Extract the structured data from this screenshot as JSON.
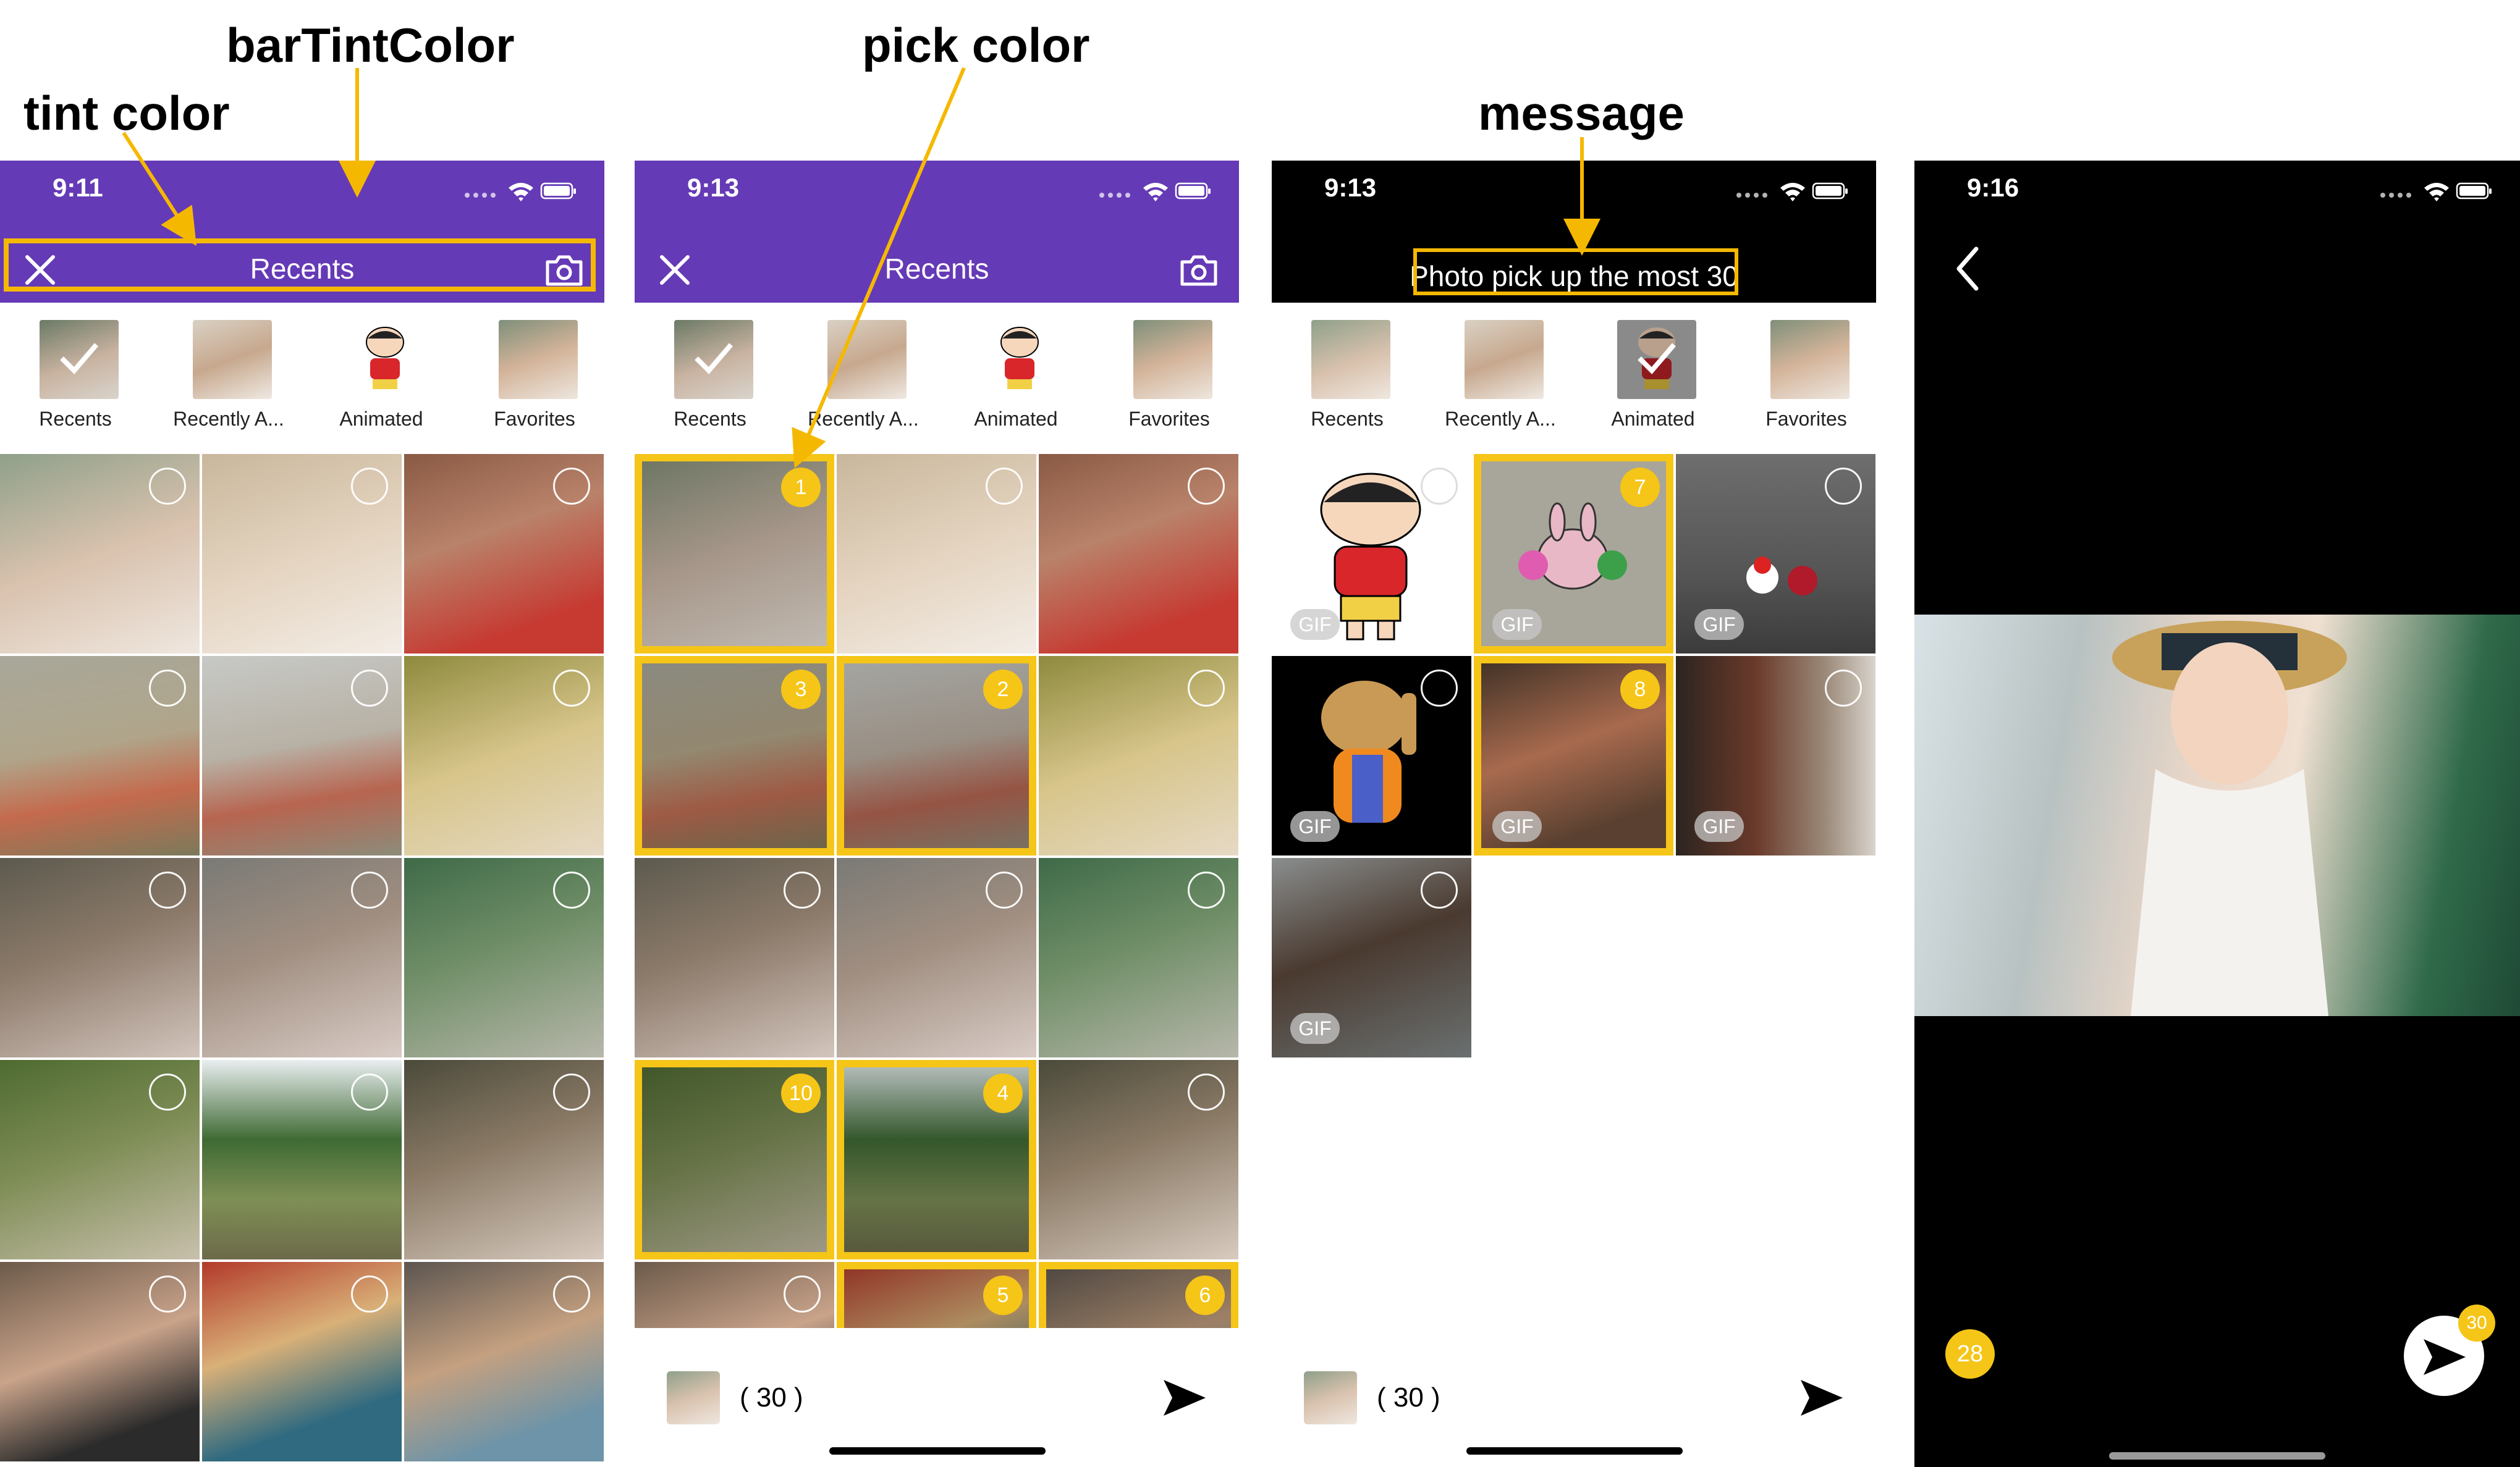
{
  "annotations": {
    "bar_tint_color": "barTintColor",
    "tint_color": "tint color",
    "pick_color": "pick color",
    "message": "message"
  },
  "colors": {
    "bar_purple": "#653ab6",
    "accent_yellow": "#f5c518",
    "annotation_line": "#f5b800",
    "dark_bar": "#000000"
  },
  "screen1": {
    "time": "9:11",
    "nav_title": "Recents",
    "left_icon": "close-icon",
    "right_icon": "camera-icon",
    "albums": [
      {
        "label": "Recents",
        "selected": true
      },
      {
        "label": "Recently A...",
        "selected": false
      },
      {
        "label": "Animated",
        "selected": false
      },
      {
        "label": "Favorites",
        "selected": false
      }
    ]
  },
  "screen2": {
    "time": "9:13",
    "nav_title": "Recents",
    "left_icon": "close-icon",
    "right_icon": "camera-icon",
    "albums": [
      {
        "label": "Recents",
        "selected": true
      },
      {
        "label": "Recently A...",
        "selected": false
      },
      {
        "label": "Animated",
        "selected": false
      },
      {
        "label": "Favorites",
        "selected": false
      }
    ],
    "selection_numbers": [
      "1",
      "3",
      "2",
      "10",
      "4",
      "5",
      "6"
    ],
    "bottom_count": "( 30 )",
    "send_icon": "send-arrow-icon"
  },
  "screen3": {
    "time": "9:13",
    "message": "Photo pick up the most 30",
    "albums": [
      {
        "label": "Recents",
        "selected": false
      },
      {
        "label": "Recently A...",
        "selected": false
      },
      {
        "label": "Animated",
        "selected": true
      },
      {
        "label": "Favorites",
        "selected": false
      }
    ],
    "gif_badge": "GIF",
    "selection_numbers": [
      "7",
      "8"
    ],
    "bottom_count": "( 30 )",
    "send_icon": "send-arrow-icon"
  },
  "screen4": {
    "time": "9:16",
    "back_icon": "back-chevron-icon",
    "left_badge": "28",
    "send_badge": "30",
    "send_icon": "send-arrow-icon"
  }
}
